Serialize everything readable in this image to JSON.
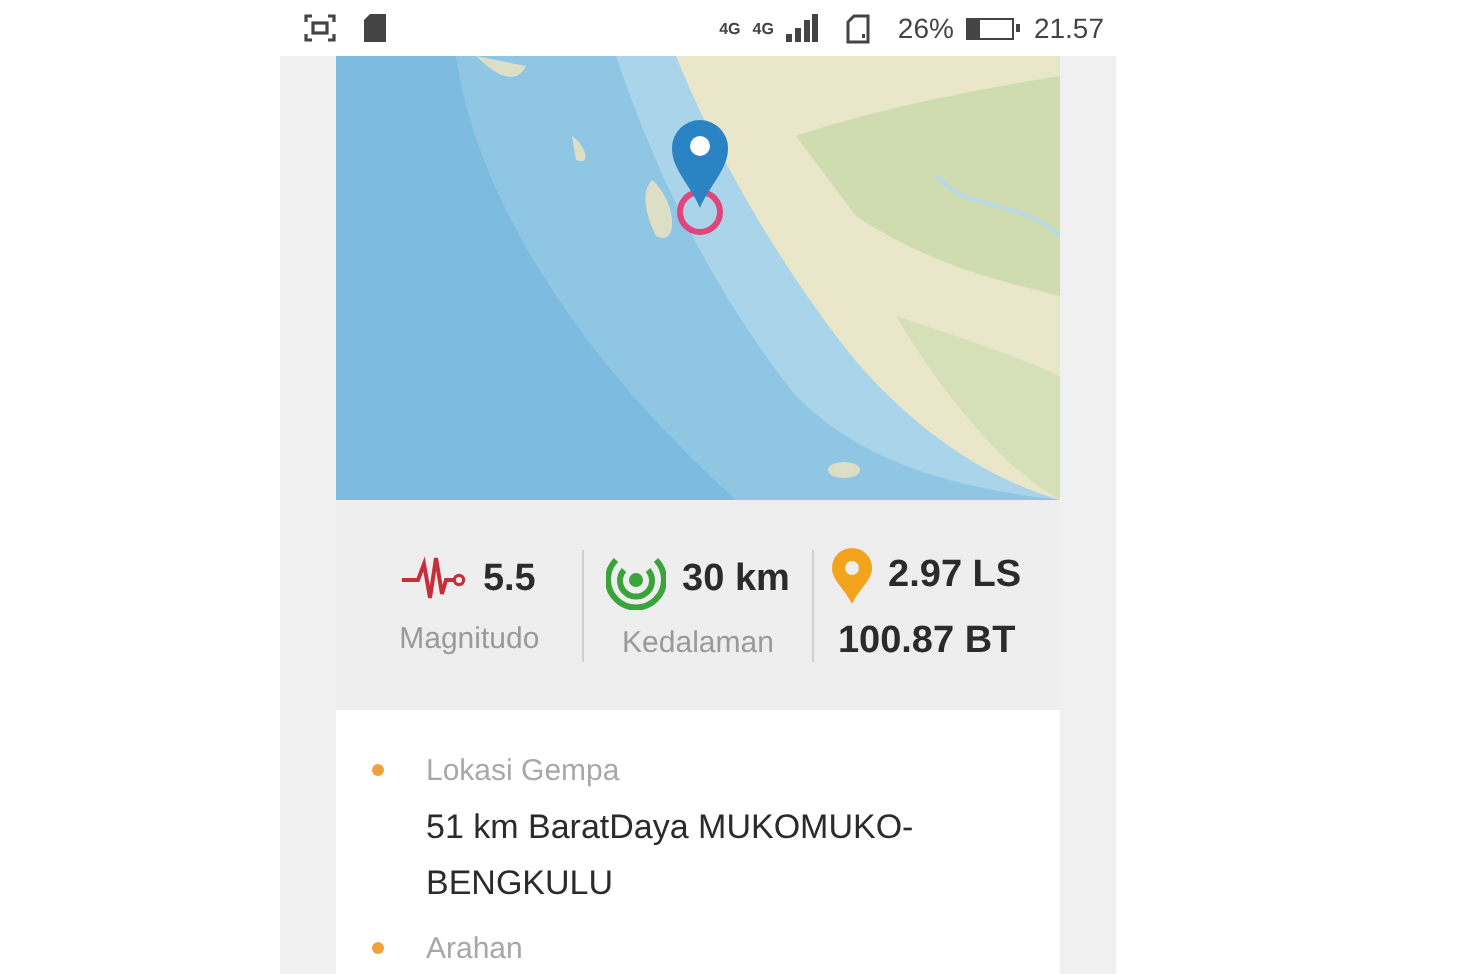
{
  "status_bar": {
    "network_labels": [
      "4G",
      "4G"
    ],
    "battery_percent": "26%",
    "battery": {
      "level": 0.26
    },
    "time": "21.57"
  },
  "stats": [
    {
      "kind": "magnitude",
      "value": "5.5",
      "label": "Magnitudo"
    },
    {
      "kind": "depth",
      "value": "30 km",
      "label": "Kedalaman"
    },
    {
      "kind": "coordinates",
      "value": "2.97 LS",
      "value_2": "100.87 BT"
    }
  ],
  "details": [
    {
      "label": "Lokasi Gempa",
      "value": "51 km BaratDaya MUKOMUKO-BENGKULU"
    },
    {
      "label": "Arahan"
    }
  ]
}
